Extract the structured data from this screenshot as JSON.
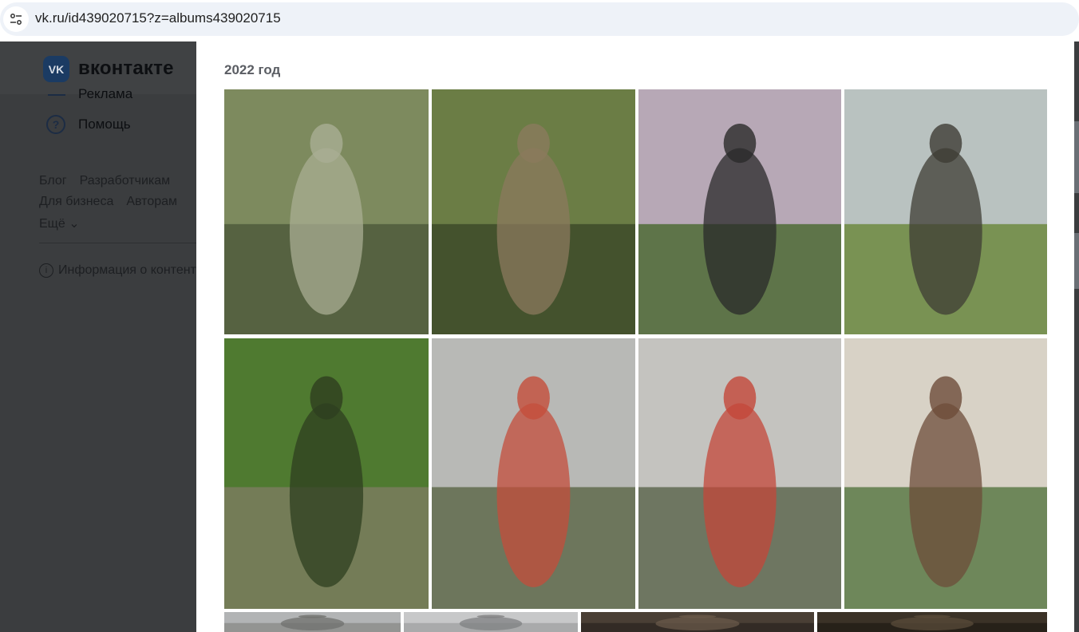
{
  "browser": {
    "url": "vk.ru/id439020715?z=albums439020715"
  },
  "sidebar": {
    "logo_text": "VK",
    "wordmark": "вконтакте",
    "partial_item": "Реклама",
    "help_label": "Помощь",
    "footer_row1": [
      "Блог",
      "Разработчикам"
    ],
    "footer_row2": [
      "Для бизнеса",
      "Авторам"
    ],
    "more_label": "Ещё",
    "info_label": "Информация о контенте"
  },
  "album": {
    "title": "2022 год",
    "photos": [
      {
        "name": "photo-soldier-on-apc",
        "colors": [
          "#7d8a5e",
          "#4f5a3c",
          "#a9ae93"
        ]
      },
      {
        "name": "photo-machine-gun-prone",
        "colors": [
          "#6b7d45",
          "#3d4a29",
          "#8b7a5d"
        ]
      },
      {
        "name": "photo-machine-gun-field",
        "colors": [
          "#b7a8b6",
          "#4f6b36",
          "#2a2a2a"
        ]
      },
      {
        "name": "photo-soldier-with-pkm",
        "colors": [
          "#b9c2c0",
          "#6d8a3f",
          "#3f3c34"
        ]
      },
      {
        "name": "photo-soldier-rifle-bushes",
        "colors": [
          "#4f7a30",
          "#7a7d5e",
          "#2e3f1f"
        ]
      },
      {
        "name": "photo-soldier-memorial",
        "colors": [
          "#b8b9b6",
          "#5f6a4c",
          "#c44d3b"
        ]
      },
      {
        "name": "photo-kneeling-memorial",
        "colors": [
          "#c4c3bf",
          "#5f6850",
          "#c4473a"
        ]
      },
      {
        "name": "photo-drawing-soldier",
        "colors": [
          "#d8d2c6",
          "#5c7a47",
          "#6e4c3a"
        ]
      },
      {
        "name": "photo-row3-1",
        "colors": [
          "#b2b4b5",
          "#8d8e8c",
          "#6f706d"
        ]
      },
      {
        "name": "photo-row3-2",
        "colors": [
          "#c7c8c9",
          "#a3a5a6",
          "#7f8081"
        ]
      },
      {
        "name": "photo-row3-3",
        "colors": [
          "#4a3f35",
          "#2f2822",
          "#6a5a4a"
        ]
      },
      {
        "name": "photo-row3-4",
        "colors": [
          "#3b3227",
          "#251f18",
          "#5a4b3a"
        ]
      }
    ]
  }
}
